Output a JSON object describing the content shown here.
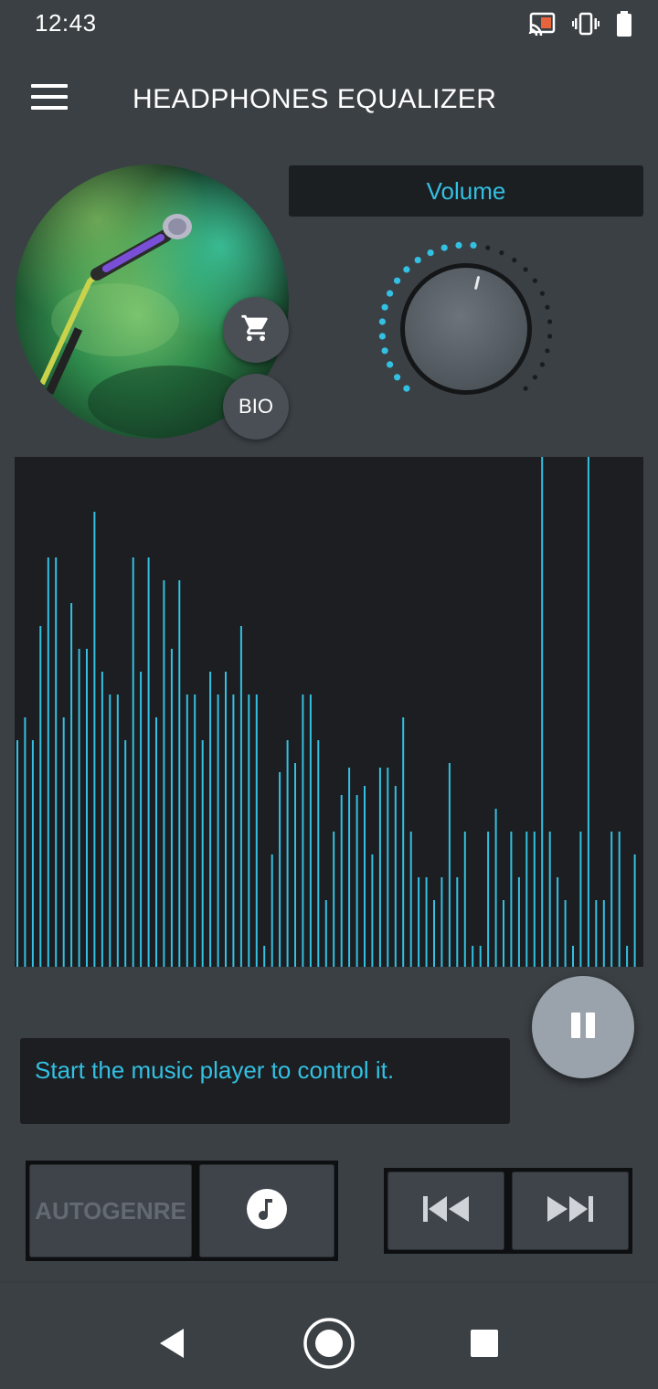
{
  "status_bar": {
    "time": "12:43",
    "icons": [
      "cast-icon",
      "vibrate-icon",
      "battery-icon"
    ]
  },
  "app_bar": {
    "title": "HEADPHONES EQUALIZER",
    "menu_icon": "menu-icon"
  },
  "album": {
    "cart_icon": "shopping-cart-icon",
    "bio_label": "BIO"
  },
  "volume": {
    "label": "Volume",
    "accent_color": "#33c0e2",
    "level": 0.55
  },
  "spectrum": {
    "bar_color": "#33c0e2",
    "max": 558,
    "bar_heights": [
      248,
      273,
      248,
      373,
      448,
      448,
      273,
      398,
      348,
      348,
      498,
      323,
      298,
      298,
      248,
      448,
      323,
      448,
      273,
      423,
      348,
      423,
      298,
      298,
      248,
      323,
      298,
      323,
      298,
      373,
      298,
      298,
      23,
      123,
      213,
      248,
      223,
      298,
      298,
      248,
      73,
      148,
      188,
      218,
      188,
      198,
      123,
      218,
      218,
      198,
      273,
      148,
      98,
      98,
      73,
      98,
      223,
      98,
      148,
      23,
      23,
      148,
      173,
      73,
      148,
      98,
      148,
      148,
      558,
      148,
      98,
      73,
      23,
      148,
      558,
      73,
      73,
      148,
      148,
      23,
      123
    ]
  },
  "message": {
    "text": "Start the music player to control it."
  },
  "controls": {
    "pause_icon": "pause-icon",
    "autogenre_label": "AUTOGENRE",
    "note_icon": "music-note-icon",
    "prev_icon": "skip-previous-icon",
    "next_icon": "skip-next-icon"
  },
  "nav_bar": {
    "back_icon": "back-icon",
    "home_icon": "home-icon",
    "recents_icon": "recents-icon"
  }
}
